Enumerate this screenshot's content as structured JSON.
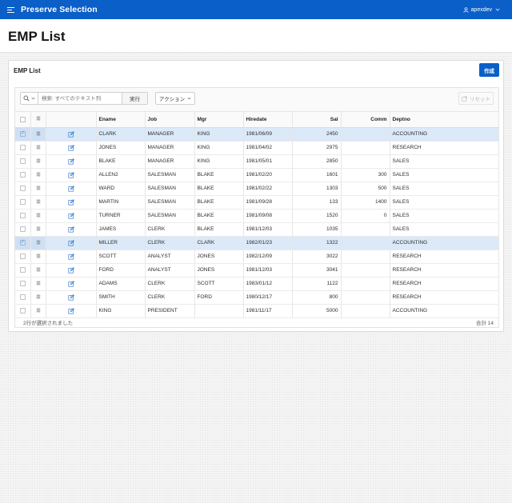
{
  "app": {
    "title": "Preserve Selection",
    "user": "apexdev"
  },
  "page": {
    "title": "EMP List"
  },
  "region": {
    "title": "EMP List",
    "create_label": "作成",
    "search_placeholder": "検索: すべてのテキスト列",
    "go_label": "実行",
    "actions_label": "アクション",
    "reset_label": "リセット"
  },
  "grid": {
    "columns": [
      "Ename",
      "Job",
      "Mgr",
      "Hiredate",
      "Sal",
      "Comm",
      "Deptno"
    ],
    "rows": [
      {
        "selected": true,
        "ename": "CLARK",
        "job": "MANAGER",
        "mgr": "KING",
        "hiredate": "1981/06/09",
        "sal": "2450",
        "comm": "",
        "deptno": "ACCOUNTING"
      },
      {
        "selected": false,
        "ename": "JONES",
        "job": "MANAGER",
        "mgr": "KING",
        "hiredate": "1981/04/02",
        "sal": "2975",
        "comm": "",
        "deptno": "RESEARCH"
      },
      {
        "selected": false,
        "ename": "BLAKE",
        "job": "MANAGER",
        "mgr": "KING",
        "hiredate": "1981/05/01",
        "sal": "2850",
        "comm": "",
        "deptno": "SALES"
      },
      {
        "selected": false,
        "ename": "ALLEN2",
        "job": "SALESMAN",
        "mgr": "BLAKE",
        "hiredate": "1981/02/20",
        "sal": "1601",
        "comm": "300",
        "deptno": "SALES"
      },
      {
        "selected": false,
        "ename": "WARD",
        "job": "SALESMAN",
        "mgr": "BLAKE",
        "hiredate": "1981/02/22",
        "sal": "1303",
        "comm": "500",
        "deptno": "SALES"
      },
      {
        "selected": false,
        "ename": "MARTIN",
        "job": "SALESMAN",
        "mgr": "BLAKE",
        "hiredate": "1981/09/28",
        "sal": "133",
        "comm": "1400",
        "deptno": "SALES"
      },
      {
        "selected": false,
        "ename": "TURNER",
        "job": "SALESMAN",
        "mgr": "BLAKE",
        "hiredate": "1981/09/08",
        "sal": "1520",
        "comm": "0",
        "deptno": "SALES"
      },
      {
        "selected": false,
        "ename": "JAMES",
        "job": "CLERK",
        "mgr": "BLAKE",
        "hiredate": "1981/12/03",
        "sal": "1035",
        "comm": "",
        "deptno": "SALES"
      },
      {
        "selected": true,
        "ename": "MILLER",
        "job": "CLERK",
        "mgr": "CLARK",
        "hiredate": "1982/01/23",
        "sal": "1322",
        "comm": "",
        "deptno": "ACCOUNTING"
      },
      {
        "selected": false,
        "ename": "SCOTT",
        "job": "ANALYST",
        "mgr": "JONES",
        "hiredate": "1982/12/09",
        "sal": "3022",
        "comm": "",
        "deptno": "RESEARCH"
      },
      {
        "selected": false,
        "ename": "FORD",
        "job": "ANALYST",
        "mgr": "JONES",
        "hiredate": "1981/12/03",
        "sal": "3041",
        "comm": "",
        "deptno": "RESEARCH"
      },
      {
        "selected": false,
        "ename": "ADAMS",
        "job": "CLERK",
        "mgr": "SCOTT",
        "hiredate": "1983/01/12",
        "sal": "1122",
        "comm": "",
        "deptno": "RESEARCH"
      },
      {
        "selected": false,
        "ename": "SMITH",
        "job": "CLERK",
        "mgr": "FORD",
        "hiredate": "1980/12/17",
        "sal": "800",
        "comm": "",
        "deptno": "RESEARCH"
      },
      {
        "selected": false,
        "ename": "KING",
        "job": "PRESIDENT",
        "mgr": "",
        "hiredate": "1981/11/17",
        "sal": "5000",
        "comm": "",
        "deptno": "ACCOUNTING"
      }
    ],
    "footer_selected": "2行が選択されました",
    "footer_total": "合計 14"
  },
  "icons": {
    "menu": "hamburger-icon",
    "user": "user-icon",
    "search": "search-icon",
    "row_actions": "row-menu-icon",
    "edit": "edit-icon"
  },
  "colors": {
    "brand": "#0a5fc8",
    "selected_row": "#dbe9f8"
  }
}
